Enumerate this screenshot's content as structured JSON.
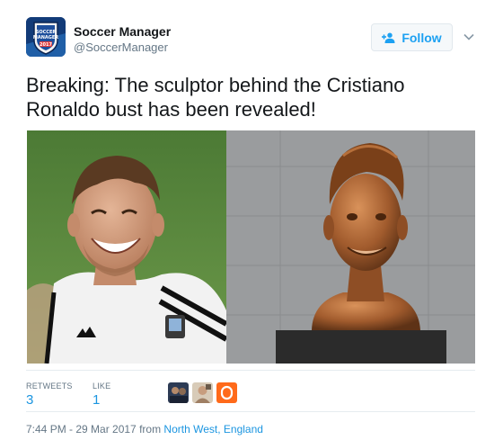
{
  "user": {
    "display_name": "Soccer Manager",
    "handle": "@SoccerManager",
    "avatar_icon": "soccer-manager-2017-badge",
    "avatar_badge_text": [
      "SOCCER",
      "MANAGER",
      "2017"
    ]
  },
  "follow": {
    "label": "Follow",
    "icon": "add-user-icon",
    "color": "#1da1f2"
  },
  "menu": {
    "icon": "chevron-down-icon"
  },
  "tweet": {
    "text_line1": "Breaking: The sculptor behind the Cristiano",
    "text_line2": "Ronaldo bust has been revealed!"
  },
  "media": {
    "left_photo": "laughing-player-in-white-jersey",
    "right_photo": "bronze-bust-sculpture"
  },
  "stats": {
    "retweets_label": "RETWEETS",
    "retweets_value": "3",
    "likes_label": "LIKE",
    "likes_value": "1",
    "liker_avatars": [
      "liker-avatar-1",
      "liker-avatar-2",
      "liker-avatar-3"
    ]
  },
  "meta": {
    "timestamp": "7:44 PM - 29 Mar 2017",
    "from_word": "from",
    "location": "North West, England"
  },
  "colors": {
    "link": "#1b95e0",
    "secondary_text": "#657786",
    "divider": "#e6ecf0"
  }
}
